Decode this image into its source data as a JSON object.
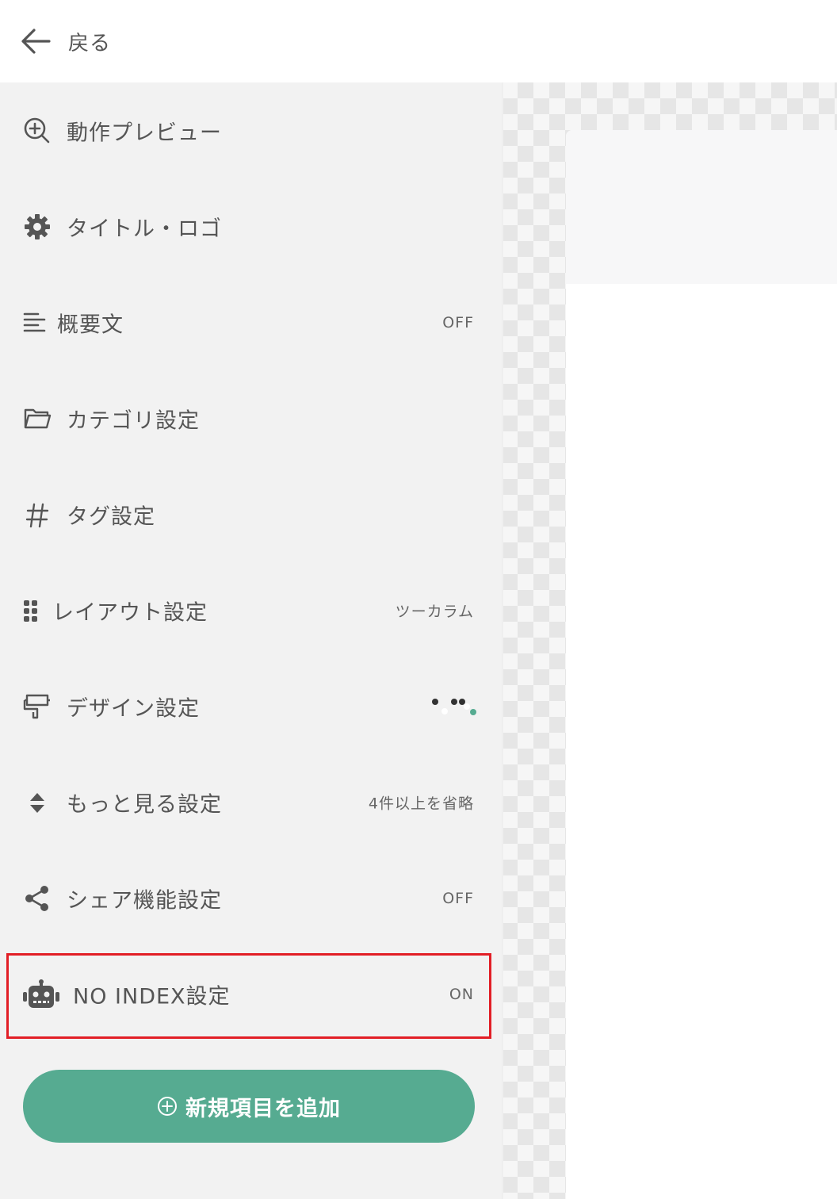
{
  "header": {
    "back_label": "戻る"
  },
  "sidebar": {
    "items": [
      {
        "label": "動作プレビュー",
        "value": ""
      },
      {
        "label": "タイトル・ロゴ",
        "value": ""
      },
      {
        "label": "概要文",
        "value": "OFF"
      },
      {
        "label": "カテゴリ設定",
        "value": ""
      },
      {
        "label": "タグ設定",
        "value": ""
      },
      {
        "label": "レイアウト設定",
        "value": "ツーカラム"
      },
      {
        "label": "デザイン設定",
        "value": ""
      },
      {
        "label": "もっと見る設定",
        "value": "4件以上を省略"
      },
      {
        "label": "シェア機能設定",
        "value": "OFF"
      },
      {
        "label": "NO INDEX設定",
        "value": "ON"
      }
    ]
  },
  "add_button": {
    "label": "新規項目を追加"
  },
  "colors": {
    "accent": "#56ab91",
    "highlight_border": "#e21e26",
    "sidebar_bg": "#f2f2f2"
  }
}
